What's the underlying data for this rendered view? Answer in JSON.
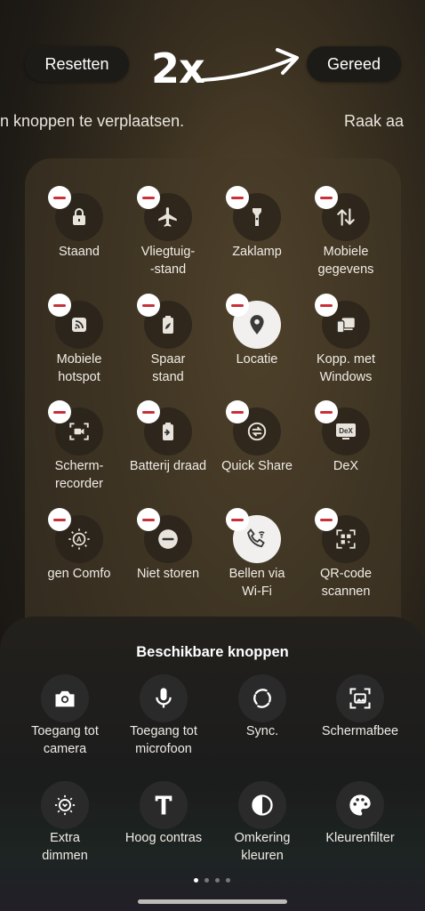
{
  "top_bar": {
    "reset_label": "Resetten",
    "done_label": "Gereed",
    "annotation": "2x"
  },
  "hint": {
    "left_text": "n knoppen te verplaatsen.",
    "right_text": "Raak aa"
  },
  "active_tiles": [
    {
      "label": "Staand",
      "icon": "lock-portrait-icon",
      "active": false
    },
    {
      "label": "Vliegtuig-\n-stand",
      "icon": "airplane-icon",
      "active": false
    },
    {
      "label": "Zaklamp",
      "icon": "flashlight-icon",
      "active": false
    },
    {
      "label": "Mobiele\ngegevens",
      "icon": "mobile-data-icon",
      "active": false
    },
    {
      "label": "Mobiele\nhotspot",
      "icon": "hotspot-icon",
      "active": false
    },
    {
      "label": "Spaar\nstand",
      "icon": "power-saving-icon",
      "active": false
    },
    {
      "label": "Locatie",
      "icon": "location-icon",
      "active": true
    },
    {
      "label": "Kopp. met\nWindows",
      "icon": "link-to-windows-icon",
      "active": false
    },
    {
      "label": "Scherm-\nrecorder",
      "icon": "screen-recorder-icon",
      "active": false
    },
    {
      "label": "Batterij draad",
      "icon": "wireless-battery-icon",
      "active": false
    },
    {
      "label": "Quick Share",
      "icon": "quick-share-icon",
      "active": false
    },
    {
      "label": "DeX",
      "icon": "dex-icon",
      "active": false
    },
    {
      "label": "gen      Comfo",
      "icon": "eye-comfort-icon",
      "active": false
    },
    {
      "label": "Niet storen",
      "icon": "do-not-disturb-icon",
      "active": false
    },
    {
      "label": "Bellen via\nWi-Fi",
      "icon": "wifi-calling-icon",
      "active": true
    },
    {
      "label": "QR-code\nscannen",
      "icon": "qr-scan-icon",
      "active": false
    }
  ],
  "available": {
    "title": "Beschikbare knoppen",
    "tiles": [
      {
        "label": "Toegang tot\ncamera",
        "icon": "camera-icon"
      },
      {
        "label": "Toegang tot\nmicrofoon",
        "icon": "microphone-icon"
      },
      {
        "label": "Sync.",
        "icon": "sync-icon"
      },
      {
        "label": "Schermafbee",
        "icon": "screenshot-icon"
      },
      {
        "label": "Extra\ndimmen",
        "icon": "extra-dim-icon"
      },
      {
        "label": "Hoog contras",
        "icon": "high-contrast-icon"
      },
      {
        "label": "Omkering\nkleuren",
        "icon": "color-inversion-icon"
      },
      {
        "label": "Kleurenfilter",
        "icon": "color-filter-icon"
      }
    ]
  },
  "pager": {
    "pages": 4,
    "current": 1
  },
  "colors": {
    "remove_badge": "#c8303a",
    "active_tile": "#f1f0ee"
  }
}
